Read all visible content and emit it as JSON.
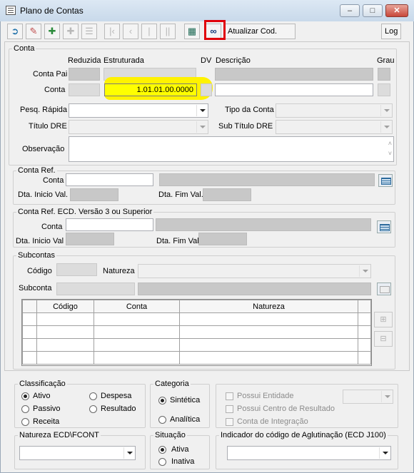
{
  "window": {
    "title": "Plano de Contas",
    "minimize": "–",
    "maximize": "□",
    "close": "✕"
  },
  "toolbar": {
    "icons": [
      "exit-icon",
      "eraser-icon",
      "add-icon",
      "tree-add-icon",
      "tree-remove-icon",
      "first-icon",
      "previous-icon",
      "next-icon",
      "last-icon",
      "list-icon",
      "binoculars-icon"
    ],
    "atualizar_label": "Atualizar Cod. Agl.",
    "log_label": "Log"
  },
  "conta": {
    "legend": "Conta",
    "col_reduzida": "Reduzida",
    "col_estruturada": "Estruturada",
    "col_dv": "DV",
    "col_descricao": "Descrição",
    "col_grau": "Grau",
    "row_conta_pai": "Conta Pai",
    "row_conta": "Conta",
    "estruturada_value": "1.01.01.00.0000",
    "pesq_rapida": "Pesq. Rápida",
    "tipo_conta": "Tipo da Conta",
    "titulo_dre": "Título DRE",
    "sub_titulo_dre": "Sub Título DRE",
    "observacao": "Observação"
  },
  "conta_ref": {
    "legend": "Conta Ref.",
    "conta": "Conta",
    "dta_inicio": "Dta. Inicio Val.",
    "dta_fim": "Dta. Fim Val."
  },
  "conta_ref_ecd": {
    "legend": "Conta Ref. ECD. Versão 3 ou Superior",
    "conta": "Conta",
    "dta_inicio": "Dta. Inicio Val",
    "dta_fim": "Dta. Fim Val"
  },
  "subcontas": {
    "legend": "Subcontas",
    "codigo": "Código",
    "natureza": "Natureza",
    "subconta": "Subconta",
    "columns": [
      "Código",
      "Conta",
      "Natureza"
    ]
  },
  "classificacao": {
    "legend": "Classificação",
    "options": [
      "Ativo",
      "Passivo",
      "Receita",
      "Despesa",
      "Resultado"
    ],
    "selected": "Ativo"
  },
  "categoria": {
    "legend": "Categoria",
    "options": [
      "Sintética",
      "Analítica"
    ],
    "selected": "Sintética"
  },
  "flags": {
    "possui_entidade": "Possui Entidade",
    "possui_centro": "Possui Centro de Resultado",
    "conta_integracao": "Conta de Integração"
  },
  "natureza_ecd": {
    "legend": "Natureza ECD\\FCONT"
  },
  "situacao": {
    "legend": "Situação",
    "options": [
      "Ativa",
      "Inativa"
    ],
    "selected": "Ativa"
  },
  "indicador": {
    "legend": "Indicador do código de Aglutinação (ECD J100)"
  },
  "colors": {
    "highlight": "#ffff00",
    "red_box": "#e0000a"
  }
}
